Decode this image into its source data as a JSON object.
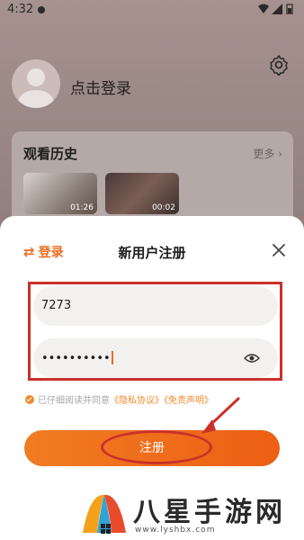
{
  "status_bar": {
    "time": "4:32"
  },
  "profile": {
    "login_prompt": "点击登录"
  },
  "history": {
    "title": "观看历史",
    "more_label": "更多",
    "items": [
      {
        "duration": "01:26"
      },
      {
        "duration": "00:02"
      }
    ]
  },
  "register_sheet": {
    "login_link": "登录",
    "title": "新用户注册",
    "phone_value": "7273",
    "password_value": "••••••••••",
    "agreement_prefix": "已仔细阅读并同意",
    "privacy_link": "《隐私协议》",
    "disclaimer_link": "《免责声明》",
    "register_button": "注册"
  },
  "watermark": {
    "text": "八星手游网",
    "url": "www.lyshbx.com"
  },
  "colors": {
    "accent": "#f06a1d",
    "annotation_red": "#c9312a"
  }
}
